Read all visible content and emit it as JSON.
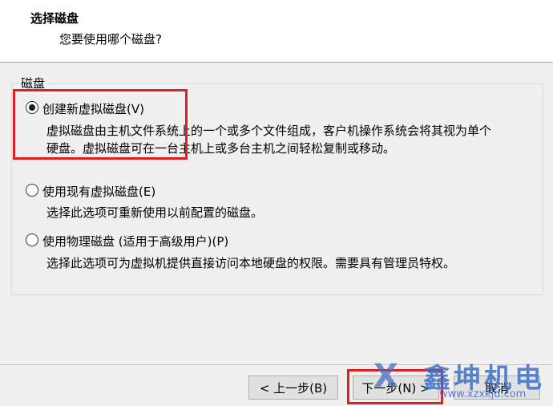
{
  "header": {
    "title": "选择磁盘",
    "subtitle": "您要使用哪个磁盘?"
  },
  "group": {
    "legend": "磁盘",
    "options": [
      {
        "label": "创建新虚拟磁盘(V)",
        "checked": true,
        "desc_lines": [
          "虚拟磁盘由主机文件系统上的一个或多个文件组成，客户机操作系统会将其视为单个",
          "硬盘。虚拟磁盘可在一台主机上或多台主机之间轻松复制或移动。"
        ]
      },
      {
        "label": "使用现有虚拟磁盘(E)",
        "checked": false,
        "desc_lines": [
          "选择此选项可重新使用以前配置的磁盘。"
        ]
      },
      {
        "label": "使用物理磁盘 (适用于高级用户)(P)",
        "checked": false,
        "desc_lines": [
          "选择此选项可为虚拟机提供直接访问本地硬盘的权限。需要具有管理员特权。"
        ]
      }
    ]
  },
  "buttons": {
    "back": "< 上一步(B)",
    "next": "下一步(N) >",
    "cancel": "取消"
  },
  "watermark": {
    "logo": "X",
    "name": "鑫坤机电",
    "url": "www.xzxkjd.com"
  },
  "colors": {
    "highlight_box": "#e02020",
    "watermark": "#3c6ec8"
  }
}
